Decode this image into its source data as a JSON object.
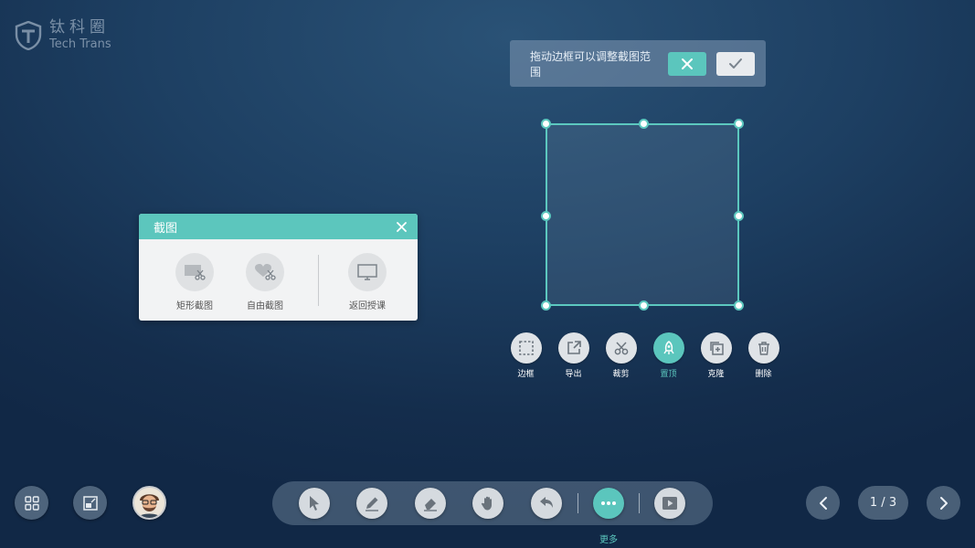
{
  "logo": {
    "cn": "钛科圈",
    "en": "Tech Trans",
    "icon": "shield-logo-icon"
  },
  "crop_hint": {
    "text": "拖动边框可以调整截图范围",
    "cancel_icon": "close-icon",
    "confirm_icon": "check-icon"
  },
  "selection_tools": [
    {
      "label": "边框",
      "icon": "border-icon"
    },
    {
      "label": "导出",
      "icon": "export-icon"
    },
    {
      "label": "裁剪",
      "icon": "scissors-icon"
    },
    {
      "label": "置顶",
      "icon": "rocket-icon"
    },
    {
      "label": "克隆",
      "icon": "clone-icon"
    },
    {
      "label": "删除",
      "icon": "trash-icon"
    }
  ],
  "screenshot_dialog": {
    "title": "截图",
    "items": [
      {
        "label": "矩形截图",
        "icon": "rect-screenshot-icon"
      },
      {
        "label": "自由截图",
        "icon": "free-screenshot-icon"
      },
      {
        "label": "返回授课",
        "icon": "monitor-icon"
      }
    ]
  },
  "toolbar": {
    "items": [
      "pointer-icon",
      "pen-icon",
      "eraser-icon",
      "hand-icon",
      "undo-icon",
      "more-icon",
      "play-icon"
    ],
    "more_label": "更多"
  },
  "pagination": {
    "indicator": "1 / 3"
  },
  "colors": {
    "accent": "#5bc6bd",
    "button_light": "#dfe3e7"
  }
}
